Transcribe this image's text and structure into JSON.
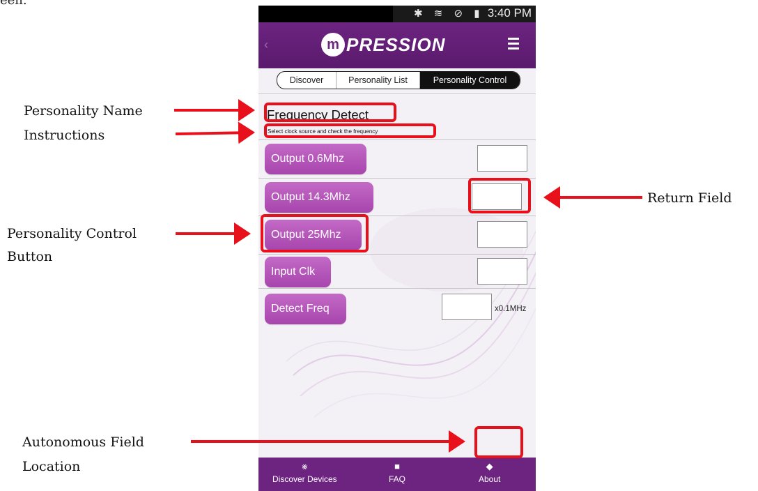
{
  "page": {
    "top_fragment": "een."
  },
  "statusbar": {
    "icons": "✱ ≋ ⊘ ▮",
    "time": "3:40 PM"
  },
  "appbar": {
    "back_glyph": "‹",
    "logo_mark": "m",
    "logo_text": "PRESSION",
    "menu_icon": "hamburger-menu-icon"
  },
  "tabs": [
    {
      "label": "Discover"
    },
    {
      "label": "Personality List"
    },
    {
      "label": "Personality Control",
      "active": true
    }
  ],
  "personality": {
    "name": "Frequency Detect",
    "instructions": "Select clock source and check the frequency"
  },
  "controls": [
    {
      "button": "Output 0.6Mhz",
      "unit": ""
    },
    {
      "button": "Output 14.3Mhz",
      "unit": ""
    },
    {
      "button": "Output 25Mhz",
      "unit": ""
    },
    {
      "button": "Input Clk",
      "unit": ""
    },
    {
      "button": "Detect Freq",
      "unit": "x0.1MHz"
    }
  ],
  "bottom_nav": [
    {
      "label": "Discover Devices",
      "icon": "bluetooth-icon"
    },
    {
      "label": "FAQ",
      "icon": "chip-icon"
    },
    {
      "label": "About",
      "icon": "info-chip-icon"
    }
  ],
  "annotations": {
    "personality_name": "Personality Name",
    "instructions": "Instructions",
    "return_field": "Return Field",
    "personality_control_button_line1": "Personality Control",
    "personality_control_button_line2": "Button",
    "autonomous_field_line1": "Autonomous Field",
    "autonomous_field_line2": "Location",
    "highlight_color": "#e8111b"
  },
  "colors": {
    "brand_purple": "#6c2480",
    "button_purple": "#b456b9"
  }
}
